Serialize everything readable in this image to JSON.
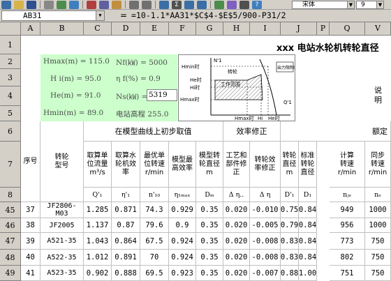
{
  "toolbar": {
    "font_name": "宋体",
    "font_size": "9"
  },
  "formula_bar": {
    "cell_ref": "AB31",
    "equals": "=",
    "formula": "=10-1.1*AA31*$C$4-$E$5/900-P31/2"
  },
  "columns": [
    "A",
    "B",
    "C",
    "D",
    "E",
    "F",
    "G",
    "H",
    "I",
    "J",
    "P",
    "Q",
    "V"
  ],
  "rows": [
    "1",
    "2",
    "3",
    "4",
    "5",
    "6",
    "7",
    "8",
    "45",
    "46",
    "47",
    "48",
    "49"
  ],
  "title": "xxx 电站水轮机转轮直径",
  "params": {
    "hmax": "Hmax(m) = 115.0",
    "hi": "H i(m) = 95.0",
    "he": "He(m) = 91.0",
    "hmin": "Hmin(m) = 89.0",
    "nf": "Nf(㎾) = 5000",
    "eta_f": "η f(%) = 0.9",
    "ns_label": "Ns(㎾) =",
    "ns_value": "5319",
    "elev": "电站高程 255.0"
  },
  "diagram": {
    "labels": [
      "Hmin时",
      "He时",
      "Hi时",
      "Hmax时",
      "N'1",
      "转轮",
      "工作范围",
      "出力限制线",
      "Q'1",
      "Hmax时",
      "Hi",
      "He时"
    ]
  },
  "remark": "说明",
  "headers": {
    "group1": "在模型曲线上初步取值",
    "group2": "效率修正",
    "group3": "额定",
    "seq": "序号",
    "model": "转轮型号",
    "q11": "取算单位流量m³/s",
    "eta": "取算水轮机效率",
    "n10": "最优单位转速r/min",
    "etamax": "模型最高效率",
    "dm": "模型转轮直径m",
    "process": "工艺和部件修正",
    "deta": "转轮效率修正",
    "d1": "转轮直径m",
    "ds": "标准转轮直径",
    "nj": "计算转速r/min",
    "ne": "同步转速r/min"
  },
  "symbols": {
    "q11": "Q'₁",
    "eta": "η'₁",
    "n10": "n'₁₀",
    "etamax": "η₁ₘₐₓ",
    "dm": "Dₘ",
    "process": "Δ η..",
    "deta": "Δ η",
    "d1": "D'₁",
    "ds": "D₁",
    "nj": "nⱼₛ",
    "ne": "nₑ"
  },
  "data_rows": [
    {
      "row": "45",
      "seq": "37",
      "model": "JF2806-M03",
      "q": "1.285",
      "eta": "0.871",
      "n10": "74.3",
      "etamax": "0.929",
      "dm": "0.35",
      "proc": "0.020",
      "deta": "-0.010",
      "d1": "0.75",
      "ds": "0.84",
      "nj": "949",
      "ne": "1000"
    },
    {
      "row": "46",
      "seq": "38",
      "model": "JF2005",
      "q": "1.137",
      "eta": "0.87",
      "n10": "79.6",
      "etamax": "0.9",
      "dm": "0.35",
      "proc": "0.020",
      "deta": "-0.005",
      "d1": "0.79",
      "ds": "0.84",
      "nj": "956",
      "ne": "1000"
    },
    {
      "row": "47",
      "seq": "39",
      "model": "A521-35",
      "q": "1.043",
      "eta": "0.864",
      "n10": "67.5",
      "etamax": "0.924",
      "dm": "0.35",
      "proc": "0.020",
      "deta": "-0.008",
      "d1": "0.83",
      "ds": "0.84",
      "nj": "773",
      "ne": "750"
    },
    {
      "row": "48",
      "seq": "40",
      "model": "A522-35",
      "q": "1.012",
      "eta": "0.891",
      "n10": "70",
      "etamax": "0.924",
      "dm": "0.35",
      "proc": "0.020",
      "deta": "-0.008",
      "d1": "0.83",
      "ds": "0.84",
      "nj": "802",
      "ne": "750"
    },
    {
      "row": "49",
      "seq": "41",
      "model": "A523-35",
      "q": "0.902",
      "eta": "0.888",
      "n10": "69.5",
      "etamax": "0.923",
      "dm": "0.35",
      "proc": "0.020",
      "deta": "-0.007",
      "d1": "0.88",
      "ds": "1.00",
      "nj": "751",
      "ne": "750"
    }
  ]
}
